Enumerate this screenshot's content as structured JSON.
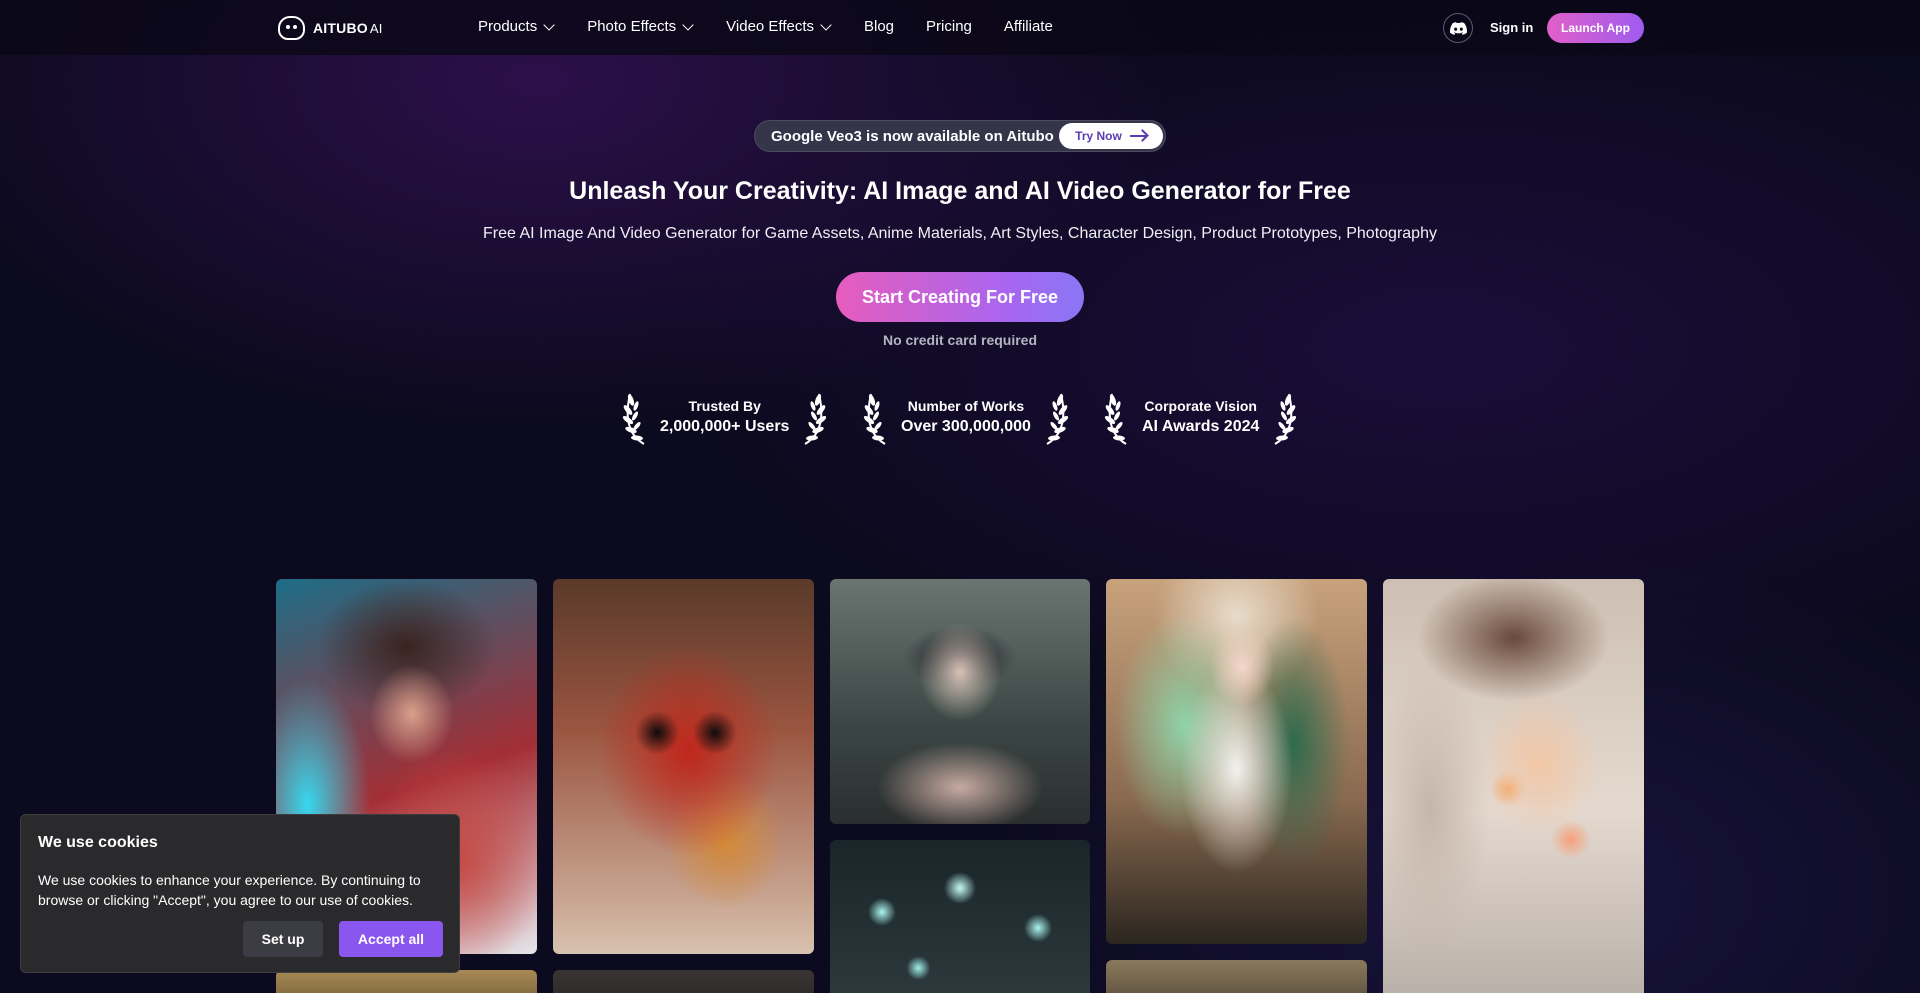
{
  "brand": {
    "name": "AITUBO",
    "suffix": "AI"
  },
  "nav": {
    "items": [
      {
        "label": "Products",
        "dropdown": true
      },
      {
        "label": "Photo Effects",
        "dropdown": true
      },
      {
        "label": "Video Effects",
        "dropdown": true
      },
      {
        "label": "Blog",
        "dropdown": false
      },
      {
        "label": "Pricing",
        "dropdown": false
      },
      {
        "label": "Affiliate",
        "dropdown": false
      }
    ],
    "discord_icon": "discord-icon",
    "sign_in": "Sign in",
    "launch_app": "Launch App"
  },
  "announcement": {
    "text": " Google Veo3 is now available on Aitubo",
    "action": "Try Now",
    "action_icon": "arrow-right-icon"
  },
  "hero": {
    "title": "Unleash Your Creativity: AI Image and AI Video Generator for Free",
    "subtitle": "Free AI Image And Video Generator for Game Assets, Anime Materials, Art Styles, Character Design, Product Prototypes, Photography",
    "cta": "Start Creating For Free",
    "note": "No credit card required"
  },
  "awards": [
    {
      "top": "Trusted By",
      "bottom": "2,000,000+ Users"
    },
    {
      "top": "Number of Works",
      "bottom": "Over 300,000,000"
    },
    {
      "top": "Corporate Vision",
      "bottom": "AI Awards 2024"
    }
  ],
  "cookie": {
    "title": "We use cookies",
    "text": "We use cookies to enhance your experience. By continuing to browse or clicking \"Accept\", you agree to our use of cookies.",
    "setup": "Set up",
    "accept": "Accept all"
  },
  "colors": {
    "accent_gradient_start": "#e05fc8",
    "accent_gradient_end": "#9f5cf0",
    "accept_button": "#8a56f0",
    "background": "#0c0a1e"
  }
}
